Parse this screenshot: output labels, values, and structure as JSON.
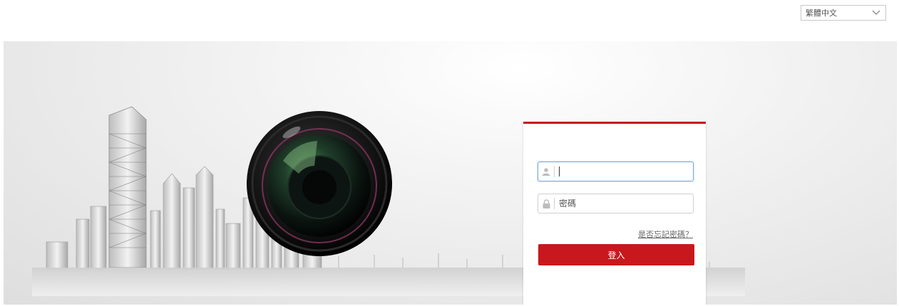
{
  "language": {
    "selected": "繁體中文"
  },
  "login": {
    "username": {
      "value": "",
      "placeholder": ""
    },
    "password": {
      "value": "",
      "placeholder": "密碼"
    },
    "forgot_label": "是否忘記密碼？",
    "submit_label": "登入"
  },
  "colors": {
    "accent": "#c9171e",
    "card_top_border": "#c41a1f",
    "focus_border": "#7aa8d8"
  },
  "icons": {
    "language_dropdown": "chevron-down-icon",
    "username": "user-icon",
    "password": "lock-icon"
  }
}
